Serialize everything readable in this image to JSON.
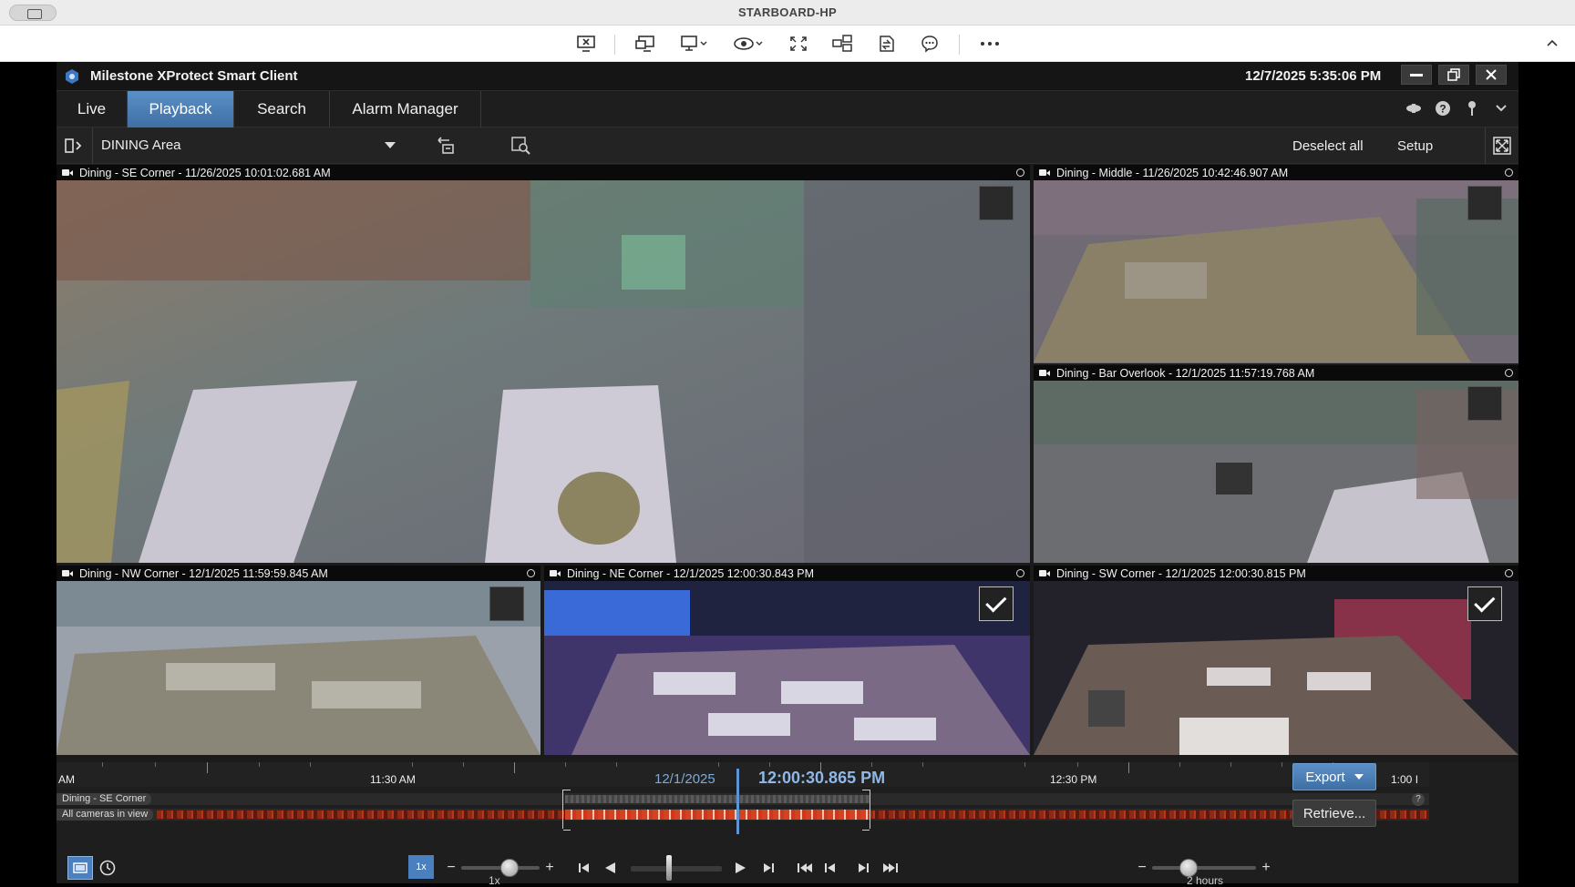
{
  "remote": {
    "title": "STARBOARD-HP"
  },
  "app": {
    "name": "Milestone XProtect Smart Client",
    "clock": "12/7/2025 5:35:06 PM",
    "tabs": [
      {
        "label": "Live"
      },
      {
        "label": "Playback"
      },
      {
        "label": "Search"
      },
      {
        "label": "Alarm Manager"
      }
    ],
    "active_tab": "Playback"
  },
  "view": {
    "name": "DINING Area",
    "deselect_label": "Deselect all",
    "setup_label": "Setup"
  },
  "cameras": [
    {
      "title": "Dining - SE Corner - 11/26/2025 10:01:02.681 AM",
      "checked": false
    },
    {
      "title": "Dining - Middle - 11/26/2025 10:42:46.907 AM",
      "checked": false
    },
    {
      "title": "Dining - Bar Overlook - 12/1/2025 11:57:19.768 AM",
      "checked": false
    },
    {
      "title": "Dining - NW Corner - 12/1/2025 11:59:59.845 AM",
      "checked": false
    },
    {
      "title": "Dining - NE Corner - 12/1/2025 12:00:30.843 PM",
      "checked": true
    },
    {
      "title": "Dining - SW Corner - 12/1/2025 12:00:30.815 PM",
      "checked": true
    }
  ],
  "timeline": {
    "labels": [
      "AM",
      "11:30 AM",
      "12:30 PM",
      "1:00 I"
    ],
    "date": "12/1/2025",
    "current_time": "12:00:30.865 PM",
    "track_camera": "Dining - SE Corner",
    "track_all": "All cameras in view",
    "help": "?",
    "speed_badge": "1x",
    "speed_value": "1x",
    "span_value": "2 hours",
    "export_label": "Export",
    "retrieve_label": "Retrieve..."
  },
  "colors": {
    "accent": "#4a85c4",
    "recording": "#c8391d",
    "cursor": "#5d95d3"
  }
}
